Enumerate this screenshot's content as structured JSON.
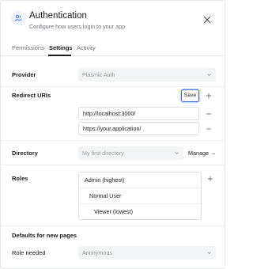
{
  "header": {
    "title": "Authentication",
    "subtitle": "Configure how users login to your app",
    "icon": "users-icon",
    "close_icon": "close-icon"
  },
  "tabs": [
    {
      "label": "Permissions",
      "active": false
    },
    {
      "label": "Settings",
      "active": true
    },
    {
      "label": "Activity",
      "active": false
    }
  ],
  "provider": {
    "label": "Provider",
    "value": "Plasmic Auth"
  },
  "redirect": {
    "label": "Redirect URIs",
    "save_label": "Save",
    "uris": [
      "http://localhost:3000/",
      "https://your.application/"
    ]
  },
  "directory": {
    "label": "Directory",
    "value": "My first directory",
    "manage_label": "Manage →"
  },
  "roles": {
    "label": "Roles",
    "items": [
      "Admin (highest)",
      "Normal User",
      "Viewer (lowest)"
    ]
  },
  "defaults": {
    "heading": "Defaults for new pages",
    "role_needed_label": "Role needed",
    "role_needed_value": "Anonymous"
  },
  "colors": {
    "accent": "#3b6fe0",
    "text": "#1b1d21",
    "muted": "#6e727a"
  }
}
